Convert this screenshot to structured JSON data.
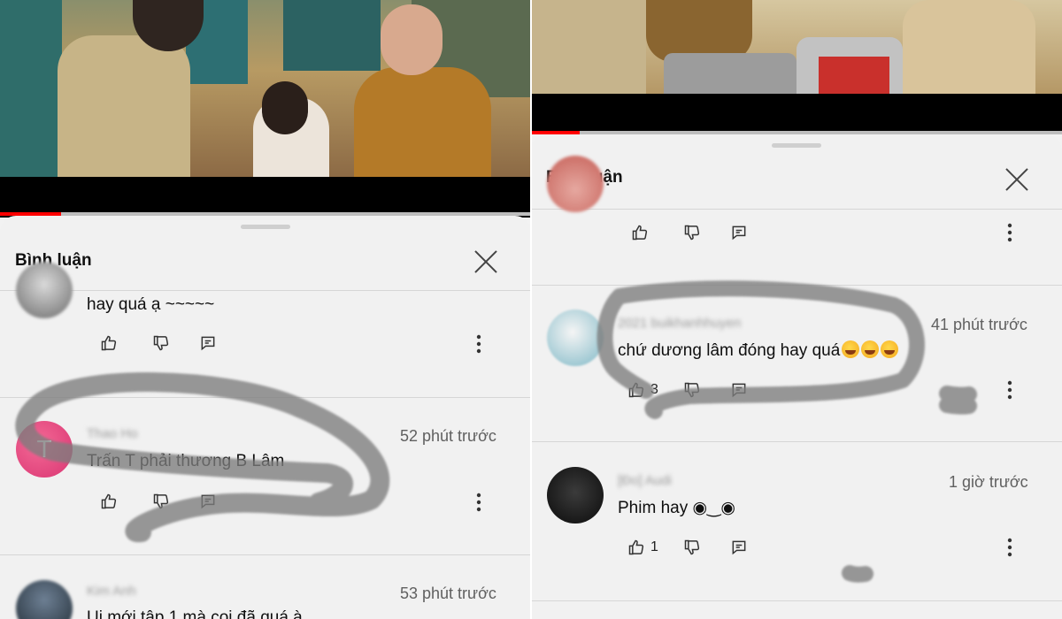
{
  "left": {
    "progress": 0.115,
    "sheet": {
      "title": "Bình luận",
      "comments": [
        {
          "author": "",
          "time": "",
          "text": "hay quá ạ ~~~~~",
          "like_count": ""
        },
        {
          "author": "Thao Ho",
          "avatar_letter": "T",
          "time": "52 phút trước",
          "text": "Trấn T phải thương B Lâm",
          "like_count": ""
        },
        {
          "author": "Kim Anh",
          "time": "53 phút trước",
          "text": "Ui mới tập 1 mà coi đã quá à",
          "like_count": ""
        }
      ]
    }
  },
  "right": {
    "progress": 0.092,
    "sheet": {
      "title": "Bình luận",
      "comments": [
        {
          "author": "",
          "time": "",
          "text": "",
          "like_count": ""
        },
        {
          "author": "2021 buikhanhhuyen",
          "time": "41 phút trước",
          "text": "chứ dương lâm đóng hay quá",
          "emoji": "laughing-emoji",
          "emoji_count": 3,
          "like_count": "3"
        },
        {
          "author": "[Đo] Audi",
          "time": "1 giờ trước",
          "text": "Phim hay ◉‿◉",
          "like_count": "1"
        }
      ]
    }
  },
  "icons": {
    "like": "thumb-up-icon",
    "dislike": "thumb-down-icon",
    "reply": "reply-icon",
    "more": "more-vertical-icon",
    "close": "close-icon"
  },
  "colors": {
    "progress": "#ff0000",
    "sheet_background": "#f1f1f1",
    "scribble": "#7d7d7d"
  }
}
